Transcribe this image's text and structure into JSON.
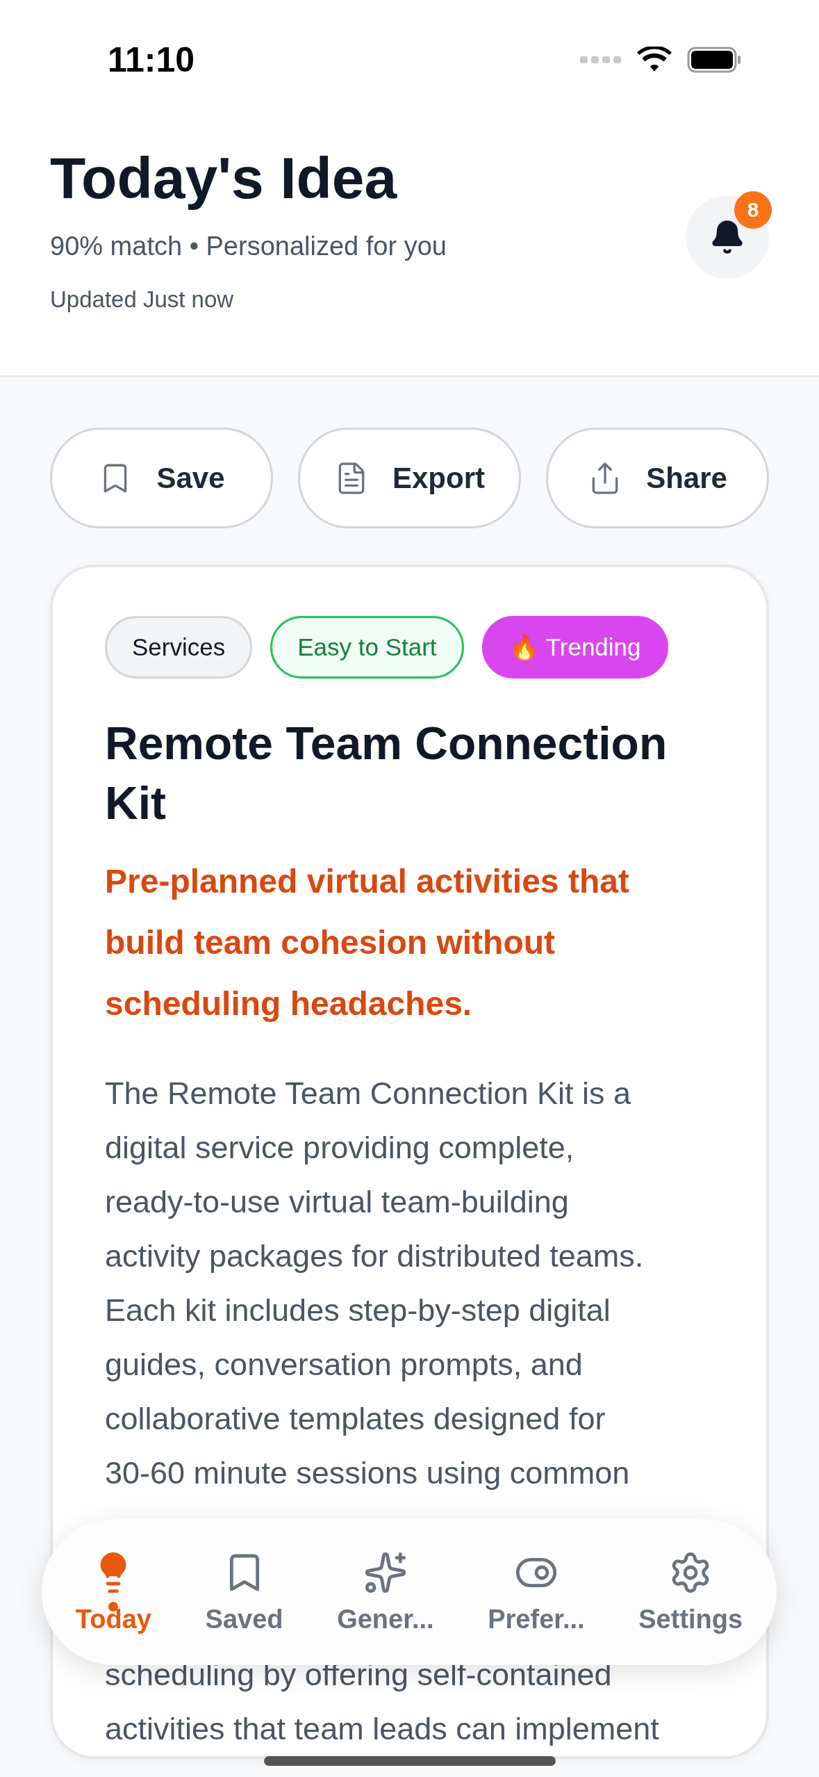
{
  "status_bar": {
    "time": "11:10"
  },
  "header": {
    "title": "Today's Idea",
    "subtitle": "90% match • Personalized for you",
    "updated": "Updated Just now",
    "notifications": {
      "count": "8"
    }
  },
  "actions": [
    {
      "kind": "save",
      "label": "Save"
    },
    {
      "kind": "export",
      "label": "Export"
    },
    {
      "kind": "share",
      "label": "Share"
    }
  ],
  "idea": {
    "tags": [
      {
        "kind": "category",
        "label": "Services"
      },
      {
        "kind": "difficulty",
        "label": "Easy to Start"
      },
      {
        "kind": "trending",
        "label": "🔥 Trending"
      }
    ],
    "title": "Remote Team Connection Kit",
    "tagline": "Pre-planned virtual activities that build team cohesion without scheduling headaches.",
    "description_lines": [
      "The Remote Team Connection Kit is a",
      "digital service providing complete,",
      "ready-to-use virtual team-building",
      "activity packages for distributed teams.",
      "Each kit includes step-by-step digital",
      "guides, conversation prompts, and",
      "collaborative templates designed for",
      "30-60 minute sessions using common"
    ],
    "description_lines_below_tab_bar": [
      "scheduling by offering self-contained",
      "activities that team leads can implement"
    ]
  },
  "tab_bar": [
    {
      "kind": "today",
      "label": "Today",
      "selected": true
    },
    {
      "kind": "saved",
      "label": "Saved",
      "selected": false
    },
    {
      "kind": "generate",
      "label": "Gener...",
      "selected": false
    },
    {
      "kind": "preferences",
      "label": "Prefer...",
      "selected": false
    },
    {
      "kind": "settings",
      "label": "Settings",
      "selected": false
    }
  ]
}
